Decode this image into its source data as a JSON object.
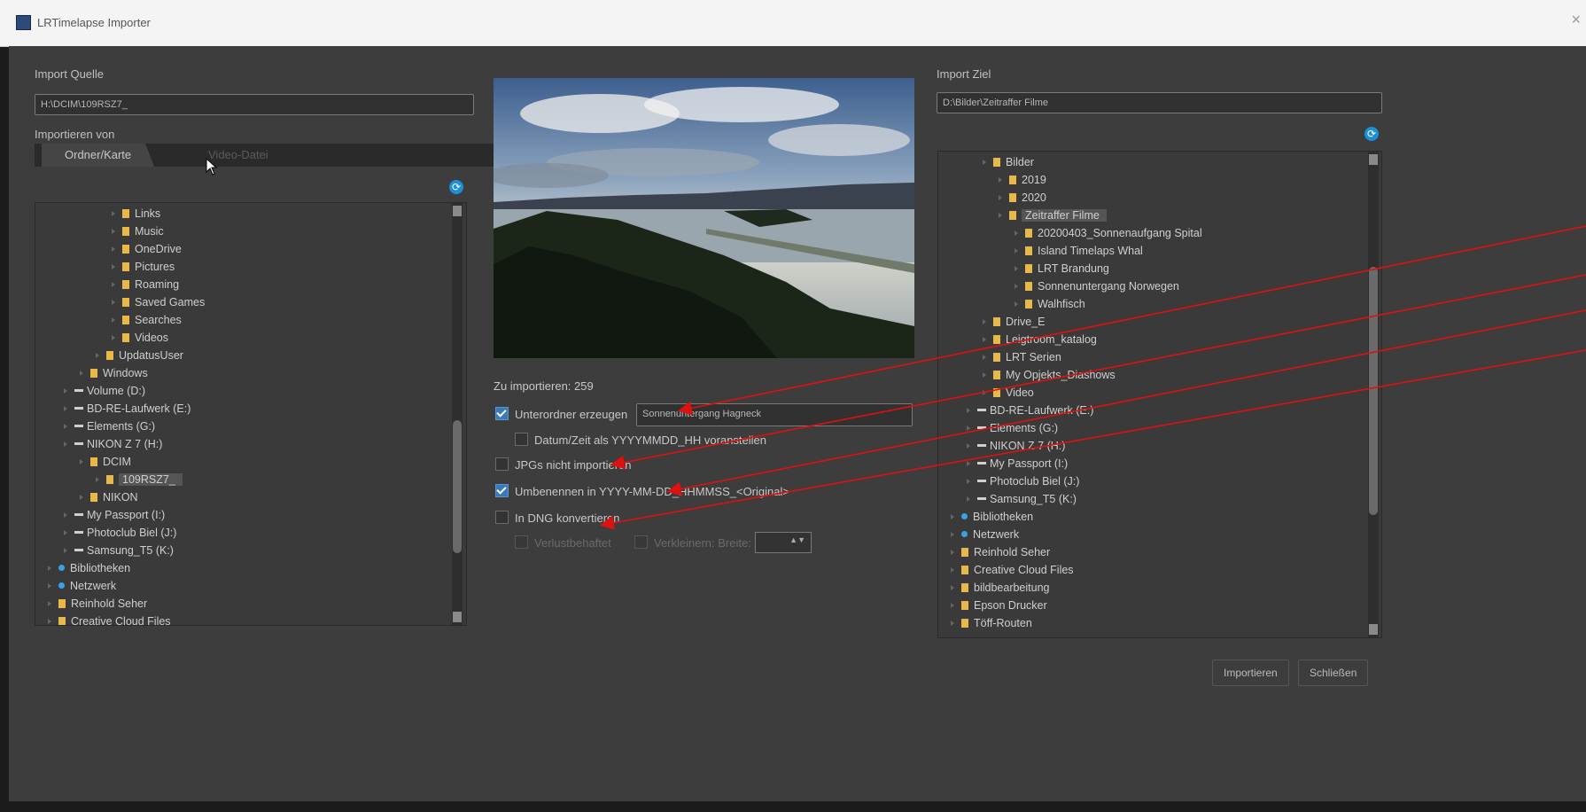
{
  "window": {
    "title": "LRTimelapse Importer",
    "close_glyph": "×"
  },
  "source": {
    "heading": "Import Quelle",
    "path": "H:\\DCIM\\109RSZ7_",
    "import_from_label": "Importieren von",
    "tabs": [
      {
        "label": "Ordner/Karte"
      },
      {
        "label": "Video-Datei"
      }
    ],
    "tree": [
      {
        "label": "Links",
        "kind": "folder",
        "indent": 4
      },
      {
        "label": "Music",
        "kind": "folder",
        "indent": 4
      },
      {
        "label": "OneDrive",
        "kind": "folder",
        "indent": 4
      },
      {
        "label": "Pictures",
        "kind": "folder",
        "indent": 4
      },
      {
        "label": "Roaming",
        "kind": "folder",
        "indent": 4
      },
      {
        "label": "Saved Games",
        "kind": "folder",
        "indent": 4
      },
      {
        "label": "Searches",
        "kind": "folder",
        "indent": 4
      },
      {
        "label": "Videos",
        "kind": "folder",
        "indent": 4
      },
      {
        "label": "UpdatusUser",
        "kind": "folder",
        "indent": 3
      },
      {
        "label": "Windows",
        "kind": "folder",
        "indent": 2
      },
      {
        "label": "Volume (D:)",
        "kind": "drive",
        "indent": 1
      },
      {
        "label": "BD-RE-Laufwerk (E:)",
        "kind": "drive",
        "indent": 1
      },
      {
        "label": "Elements (G:)",
        "kind": "drive",
        "indent": 1
      },
      {
        "label": "NIKON Z 7   (H:)",
        "kind": "drive",
        "indent": 1
      },
      {
        "label": "DCIM",
        "kind": "folder",
        "indent": 2
      },
      {
        "label": "109RSZ7_",
        "kind": "folder",
        "indent": 3,
        "selected": true
      },
      {
        "label": "NIKON",
        "kind": "folder",
        "indent": 2
      },
      {
        "label": "My Passport (I:)",
        "kind": "drive",
        "indent": 1
      },
      {
        "label": "Photoclub Biel (J:)",
        "kind": "drive",
        "indent": 1
      },
      {
        "label": "Samsung_T5 (K:)",
        "kind": "drive",
        "indent": 1
      },
      {
        "label": "Bibliotheken",
        "kind": "net",
        "indent": 0
      },
      {
        "label": "Netzwerk",
        "kind": "net",
        "indent": 0
      },
      {
        "label": "Reinhold Seher",
        "kind": "folder",
        "indent": 0
      },
      {
        "label": "Creative Cloud Files",
        "kind": "folder",
        "indent": 0
      }
    ]
  },
  "middle": {
    "count_label": "Zu importieren: 259",
    "subfolder": {
      "label": "Unterordner erzeugen",
      "checked": true,
      "value": "Sonnenuntergang Hagneck"
    },
    "date_prefix": {
      "label": "Datum/Zeit als YYYYMMDD_HH voranstellen",
      "checked": false
    },
    "skip_jpg": {
      "label": "JPGs nicht importieren",
      "checked": false
    },
    "rename": {
      "label": "Umbenennen in YYYY-MM-DD_HHMMSS_<Original>",
      "checked": true
    },
    "dng": {
      "label": "In DNG konvertieren",
      "checked": false
    },
    "lossy": {
      "label": "Verlustbehaftet",
      "checked": false
    },
    "shrink": {
      "label": "Verkleinern: Breite:",
      "checked": false
    }
  },
  "target": {
    "heading": "Import Ziel",
    "path": "D:\\Bilder\\Zeitraffer Filme",
    "tree": [
      {
        "label": "Bilder",
        "kind": "folder",
        "indent": 2
      },
      {
        "label": "2019",
        "kind": "folder",
        "indent": 3
      },
      {
        "label": "2020",
        "kind": "folder",
        "indent": 3
      },
      {
        "label": "Zeitraffer Filme",
        "kind": "folder",
        "indent": 3,
        "selected": true
      },
      {
        "label": "20200403_Sonnenaufgang Spital",
        "kind": "folder",
        "indent": 4
      },
      {
        "label": "Island Timelaps Whal",
        "kind": "folder",
        "indent": 4
      },
      {
        "label": "LRT Brandung",
        "kind": "folder",
        "indent": 4
      },
      {
        "label": "Sonnenuntergang Norwegen",
        "kind": "folder",
        "indent": 4
      },
      {
        "label": "Walhfisch",
        "kind": "folder",
        "indent": 4
      },
      {
        "label": "Drive_E",
        "kind": "folder",
        "indent": 2
      },
      {
        "label": "Leigtroom_katalog",
        "kind": "folder",
        "indent": 2
      },
      {
        "label": "LRT Serien",
        "kind": "folder",
        "indent": 2
      },
      {
        "label": "My Opjekts_Diashows",
        "kind": "folder",
        "indent": 2
      },
      {
        "label": "Video",
        "kind": "folder",
        "indent": 2
      },
      {
        "label": "BD-RE-Laufwerk (E:)",
        "kind": "drive",
        "indent": 1
      },
      {
        "label": "Elements (G:)",
        "kind": "drive",
        "indent": 1
      },
      {
        "label": "NIKON Z 7   (H:)",
        "kind": "drive",
        "indent": 1
      },
      {
        "label": "My Passport (I:)",
        "kind": "drive",
        "indent": 1
      },
      {
        "label": "Photoclub Biel (J:)",
        "kind": "drive",
        "indent": 1
      },
      {
        "label": "Samsung_T5 (K:)",
        "kind": "drive",
        "indent": 1
      },
      {
        "label": "Bibliotheken",
        "kind": "net",
        "indent": 0
      },
      {
        "label": "Netzwerk",
        "kind": "net",
        "indent": 0
      },
      {
        "label": "Reinhold Seher",
        "kind": "folder",
        "indent": 0
      },
      {
        "label": "Creative Cloud Files",
        "kind": "folder",
        "indent": 0
      },
      {
        "label": "bildbearbeitung",
        "kind": "folder",
        "indent": 0
      },
      {
        "label": "Epson Drucker",
        "kind": "folder",
        "indent": 0
      },
      {
        "label": "Töff-Routen",
        "kind": "folder",
        "indent": 0
      }
    ]
  },
  "buttons": {
    "import": "Importieren",
    "close": "Schließen"
  },
  "colors": {
    "annotation_arrow": "#e01010",
    "folder": "#e8b84a",
    "checkbox": "#3a7ab8",
    "network": "#3ca0e8"
  },
  "icons": {
    "refresh": "refresh-icon",
    "folder": "folder-icon",
    "drive": "drive-icon",
    "network": "network-icon",
    "close": "close-icon"
  }
}
